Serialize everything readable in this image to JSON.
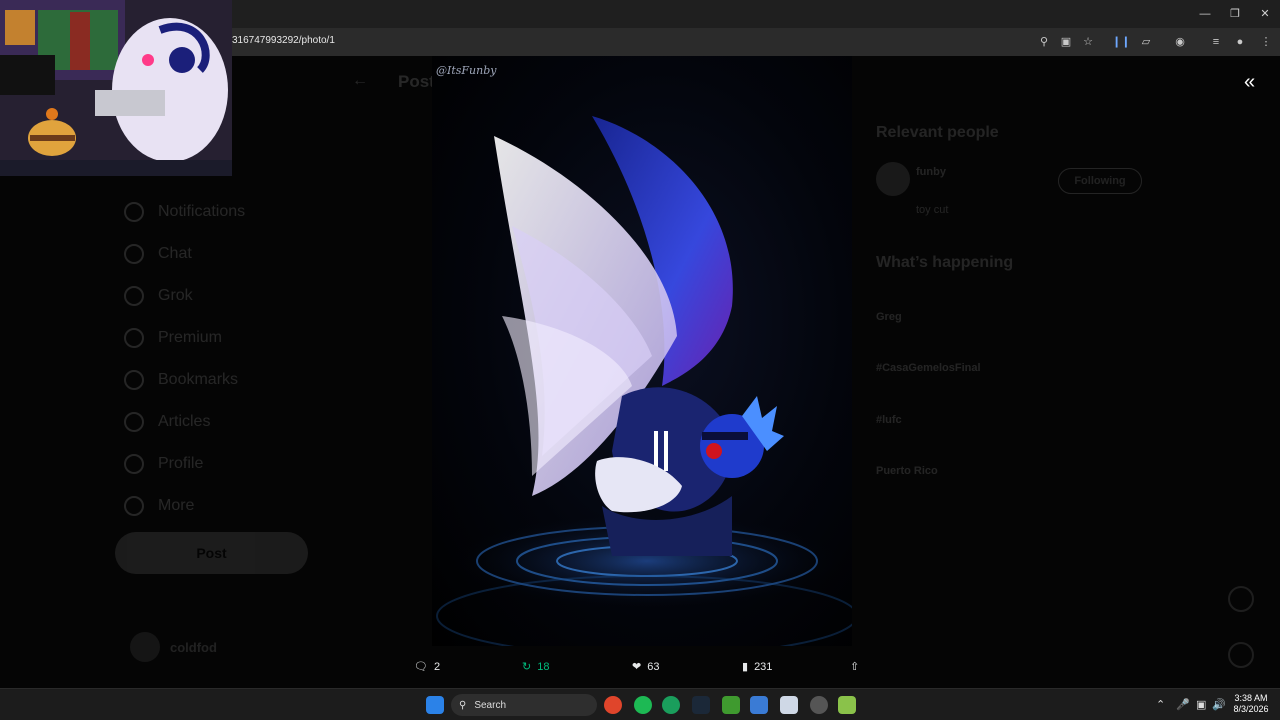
{
  "browser": {
    "url": "316747993292/photo/1",
    "window_controls": [
      "minimize",
      "restore",
      "close"
    ]
  },
  "left_nav": {
    "items": [
      {
        "label": "Notifications",
        "icon": "bell-icon"
      },
      {
        "label": "Chat",
        "icon": "chat-icon"
      },
      {
        "label": "Grok",
        "icon": "grok-icon"
      },
      {
        "label": "Premium",
        "icon": "premium-icon"
      },
      {
        "label": "Bookmarks",
        "icon": "bookmark-icon"
      },
      {
        "label": "Articles",
        "icon": "articles-icon"
      },
      {
        "label": "Profile",
        "icon": "profile-icon"
      },
      {
        "label": "More",
        "icon": "more-icon"
      }
    ],
    "post_button": "Post",
    "account_name": "coldfod"
  },
  "middle": {
    "title": "Post"
  },
  "image": {
    "watermark": "@ItsFunby"
  },
  "right_column": {
    "relevant_people_heading": "Relevant people",
    "person_name": "funby",
    "person_bio": "toy cut",
    "follow_label": "Following",
    "whats_happening_heading": "What’s happening",
    "trends": [
      "Greg",
      "#CasaGemelosFinal",
      "#lufc",
      "Puerto Rico"
    ]
  },
  "actions": {
    "replies": "2",
    "reposts": "18",
    "likes": "63",
    "views": "231"
  },
  "taskbar": {
    "search_placeholder": "Search",
    "time": "3:38 AM",
    "date": "8/3/2026"
  },
  "colors": {
    "repost_green": "#00ba7c",
    "page_bg": "#000000"
  }
}
